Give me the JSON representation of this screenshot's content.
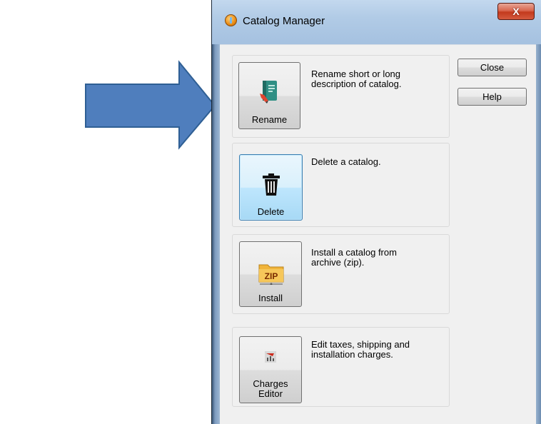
{
  "window": {
    "title": "Catalog Manager",
    "close_glyph": "X"
  },
  "actions": [
    {
      "label": "Rename",
      "description_lines": [
        "Rename short or long",
        "description of catalog."
      ],
      "icon": "notebook-icon"
    },
    {
      "label": "Delete",
      "description_lines": [
        "Delete a catalog."
      ],
      "icon": "trash-icon"
    },
    {
      "label": "Install",
      "description_lines": [
        "Install a catalog from",
        "archive (zip)."
      ],
      "icon": "zip-folder-icon"
    },
    {
      "label_lines": [
        "Charges",
        "Editor"
      ],
      "description_lines": [
        "Edit taxes, shipping and",
        "installation charges."
      ],
      "icon": "charges-editor-icon"
    }
  ],
  "side_buttons": {
    "close": "Close",
    "help": "Help"
  },
  "colors": {
    "arrow_fill": "#4f7ebd",
    "arrow_stroke": "#2f5f94",
    "focus_border": "#3c7fb1"
  }
}
